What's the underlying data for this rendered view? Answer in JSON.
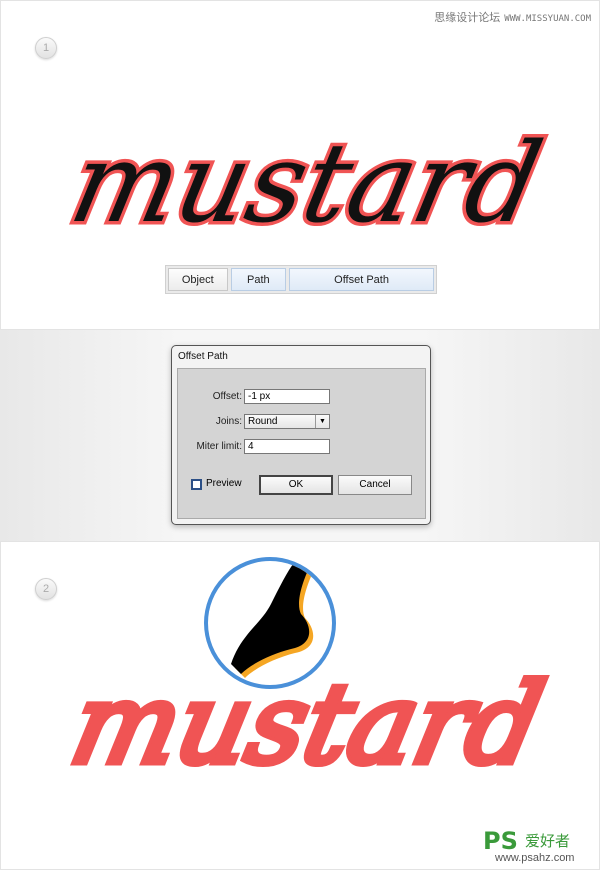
{
  "watermark_top": {
    "cn": "思缘设计论坛",
    "en": "WWW.MISSYUAN.COM"
  },
  "steps": [
    "1",
    "2"
  ],
  "artwork_word": "mustard",
  "menu": {
    "items": [
      {
        "label": "Object"
      },
      {
        "label": "Path"
      },
      {
        "label": "Offset Path"
      }
    ],
    "selected": "Offset Path"
  },
  "dialog": {
    "title": "Offset Path",
    "offset_label": "Offset:",
    "offset_value": "-1 px",
    "joins_label": "Joins:",
    "joins_value": "Round",
    "miter_label": "Miter limit:",
    "miter_value": "4",
    "preview_label": "Preview",
    "preview_checked": false,
    "ok_label": "OK",
    "cancel_label": "Cancel"
  },
  "watermark_bottom": {
    "logo": "PS",
    "cn": "爱好者",
    "url": "www.psahz.com"
  },
  "colors": {
    "stroke": "#f05454",
    "fill": "#000000",
    "accent": "#f5a623",
    "lens": "#4a90d9"
  }
}
